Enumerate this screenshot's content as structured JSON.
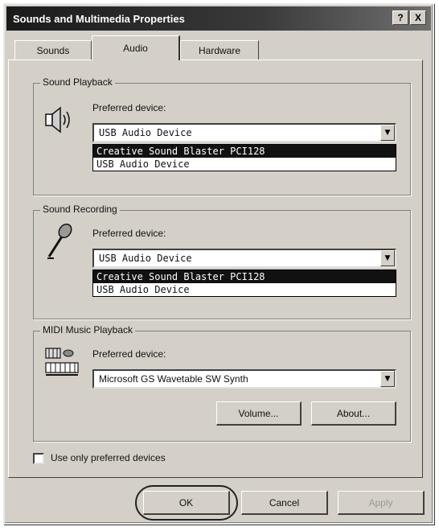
{
  "window": {
    "title": "Sounds and Multimedia Properties",
    "help_label": "?",
    "close_label": "X"
  },
  "tabs": [
    {
      "label": "Sounds"
    },
    {
      "label": "Audio"
    },
    {
      "label": "Hardware"
    }
  ],
  "sound_playback": {
    "group_label": "Sound Playback",
    "field_label": "Preferred device:",
    "selected": "USB Audio Device",
    "options": [
      "Creative Sound Blaster PCI128",
      "USB Audio Device"
    ]
  },
  "sound_recording": {
    "group_label": "Sound Recording",
    "field_label": "Preferred device:",
    "selected": "USB Audio Device",
    "options": [
      "Creative Sound Blaster PCI128",
      "USB Audio Device"
    ]
  },
  "midi_playback": {
    "group_label": "MIDI Music Playback",
    "field_label": "Preferred device:",
    "selected": "Microsoft GS Wavetable SW Synth",
    "volume_label": "Volume...",
    "about_label": "About..."
  },
  "use_preferred": {
    "label": "Use only preferred devices",
    "checked": false
  },
  "footer": {
    "ok_label": "OK",
    "cancel_label": "Cancel",
    "apply_label": "Apply"
  },
  "icons": {
    "playback": "speaker-icon",
    "recording": "microphone-icon",
    "midi": "midi-keyboard-icon",
    "dropdown": "chevron-down-icon"
  }
}
